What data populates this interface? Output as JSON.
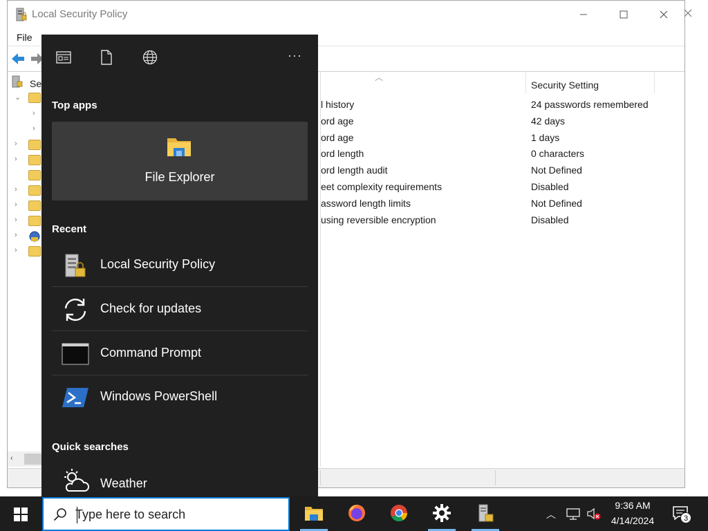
{
  "window": {
    "title": "Local Security Policy",
    "menu": [
      "File"
    ],
    "tree_root_label": "Sec"
  },
  "list": {
    "column_setting": "Security Setting",
    "rows": [
      {
        "name": "l history",
        "value": "24 passwords remembered"
      },
      {
        "name": "ord age",
        "value": "42 days"
      },
      {
        "name": "ord age",
        "value": "1 days"
      },
      {
        "name": "ord length",
        "value": "0 characters"
      },
      {
        "name": "ord length audit",
        "value": "Not Defined"
      },
      {
        "name": "eet complexity requirements",
        "value": "Disabled"
      },
      {
        "name": "assword length limits",
        "value": "Not Defined"
      },
      {
        "name": "using reversible encryption",
        "value": "Disabled"
      }
    ]
  },
  "search_panel": {
    "more_label": "···",
    "top_apps_title": "Top apps",
    "top_app": "File Explorer",
    "recent_title": "Recent",
    "recent": [
      {
        "label": "Local Security Policy",
        "icon": "security-policy-icon"
      },
      {
        "label": "Check for updates",
        "icon": "sync-icon"
      },
      {
        "label": "Command Prompt",
        "icon": "cmd-icon"
      },
      {
        "label": "Windows PowerShell",
        "icon": "powershell-icon"
      }
    ],
    "quick_title": "Quick searches",
    "quick": [
      {
        "label": "Weather",
        "icon": "weather-icon"
      }
    ]
  },
  "taskbar": {
    "search_placeholder": "Type here to search",
    "apps": [
      "file-explorer",
      "firefox",
      "chrome",
      "settings",
      "local-security-policy"
    ],
    "time": "9:36 AM",
    "date": "4/14/2024",
    "notification_count": "3"
  },
  "colors": {
    "panel_bg": "#202020",
    "tile_bg": "#3b3b3b",
    "taskbar_bg": "#1d1d1d",
    "accent": "#0078d7"
  }
}
